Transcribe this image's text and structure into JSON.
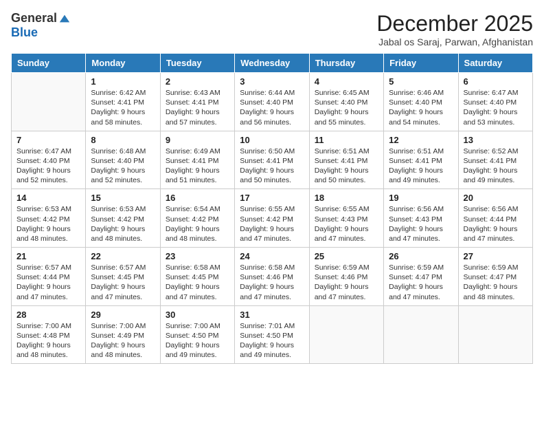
{
  "logo": {
    "general": "General",
    "blue": "Blue"
  },
  "title": "December 2025",
  "location": "Jabal os Saraj, Parwan, Afghanistan",
  "days_header": [
    "Sunday",
    "Monday",
    "Tuesday",
    "Wednesday",
    "Thursday",
    "Friday",
    "Saturday"
  ],
  "weeks": [
    [
      {
        "day": "",
        "info": ""
      },
      {
        "day": "1",
        "info": "Sunrise: 6:42 AM\nSunset: 4:41 PM\nDaylight: 9 hours\nand 58 minutes."
      },
      {
        "day": "2",
        "info": "Sunrise: 6:43 AM\nSunset: 4:41 PM\nDaylight: 9 hours\nand 57 minutes."
      },
      {
        "day": "3",
        "info": "Sunrise: 6:44 AM\nSunset: 4:40 PM\nDaylight: 9 hours\nand 56 minutes."
      },
      {
        "day": "4",
        "info": "Sunrise: 6:45 AM\nSunset: 4:40 PM\nDaylight: 9 hours\nand 55 minutes."
      },
      {
        "day": "5",
        "info": "Sunrise: 6:46 AM\nSunset: 4:40 PM\nDaylight: 9 hours\nand 54 minutes."
      },
      {
        "day": "6",
        "info": "Sunrise: 6:47 AM\nSunset: 4:40 PM\nDaylight: 9 hours\nand 53 minutes."
      }
    ],
    [
      {
        "day": "7",
        "info": "Sunrise: 6:47 AM\nSunset: 4:40 PM\nDaylight: 9 hours\nand 52 minutes."
      },
      {
        "day": "8",
        "info": "Sunrise: 6:48 AM\nSunset: 4:40 PM\nDaylight: 9 hours\nand 52 minutes."
      },
      {
        "day": "9",
        "info": "Sunrise: 6:49 AM\nSunset: 4:41 PM\nDaylight: 9 hours\nand 51 minutes."
      },
      {
        "day": "10",
        "info": "Sunrise: 6:50 AM\nSunset: 4:41 PM\nDaylight: 9 hours\nand 50 minutes."
      },
      {
        "day": "11",
        "info": "Sunrise: 6:51 AM\nSunset: 4:41 PM\nDaylight: 9 hours\nand 50 minutes."
      },
      {
        "day": "12",
        "info": "Sunrise: 6:51 AM\nSunset: 4:41 PM\nDaylight: 9 hours\nand 49 minutes."
      },
      {
        "day": "13",
        "info": "Sunrise: 6:52 AM\nSunset: 4:41 PM\nDaylight: 9 hours\nand 49 minutes."
      }
    ],
    [
      {
        "day": "14",
        "info": "Sunrise: 6:53 AM\nSunset: 4:42 PM\nDaylight: 9 hours\nand 48 minutes."
      },
      {
        "day": "15",
        "info": "Sunrise: 6:53 AM\nSunset: 4:42 PM\nDaylight: 9 hours\nand 48 minutes."
      },
      {
        "day": "16",
        "info": "Sunrise: 6:54 AM\nSunset: 4:42 PM\nDaylight: 9 hours\nand 48 minutes."
      },
      {
        "day": "17",
        "info": "Sunrise: 6:55 AM\nSunset: 4:42 PM\nDaylight: 9 hours\nand 47 minutes."
      },
      {
        "day": "18",
        "info": "Sunrise: 6:55 AM\nSunset: 4:43 PM\nDaylight: 9 hours\nand 47 minutes."
      },
      {
        "day": "19",
        "info": "Sunrise: 6:56 AM\nSunset: 4:43 PM\nDaylight: 9 hours\nand 47 minutes."
      },
      {
        "day": "20",
        "info": "Sunrise: 6:56 AM\nSunset: 4:44 PM\nDaylight: 9 hours\nand 47 minutes."
      }
    ],
    [
      {
        "day": "21",
        "info": "Sunrise: 6:57 AM\nSunset: 4:44 PM\nDaylight: 9 hours\nand 47 minutes."
      },
      {
        "day": "22",
        "info": "Sunrise: 6:57 AM\nSunset: 4:45 PM\nDaylight: 9 hours\nand 47 minutes."
      },
      {
        "day": "23",
        "info": "Sunrise: 6:58 AM\nSunset: 4:45 PM\nDaylight: 9 hours\nand 47 minutes."
      },
      {
        "day": "24",
        "info": "Sunrise: 6:58 AM\nSunset: 4:46 PM\nDaylight: 9 hours\nand 47 minutes."
      },
      {
        "day": "25",
        "info": "Sunrise: 6:59 AM\nSunset: 4:46 PM\nDaylight: 9 hours\nand 47 minutes."
      },
      {
        "day": "26",
        "info": "Sunrise: 6:59 AM\nSunset: 4:47 PM\nDaylight: 9 hours\nand 47 minutes."
      },
      {
        "day": "27",
        "info": "Sunrise: 6:59 AM\nSunset: 4:47 PM\nDaylight: 9 hours\nand 48 minutes."
      }
    ],
    [
      {
        "day": "28",
        "info": "Sunrise: 7:00 AM\nSunset: 4:48 PM\nDaylight: 9 hours\nand 48 minutes."
      },
      {
        "day": "29",
        "info": "Sunrise: 7:00 AM\nSunset: 4:49 PM\nDaylight: 9 hours\nand 48 minutes."
      },
      {
        "day": "30",
        "info": "Sunrise: 7:00 AM\nSunset: 4:50 PM\nDaylight: 9 hours\nand 49 minutes."
      },
      {
        "day": "31",
        "info": "Sunrise: 7:01 AM\nSunset: 4:50 PM\nDaylight: 9 hours\nand 49 minutes."
      },
      {
        "day": "",
        "info": ""
      },
      {
        "day": "",
        "info": ""
      },
      {
        "day": "",
        "info": ""
      }
    ]
  ]
}
